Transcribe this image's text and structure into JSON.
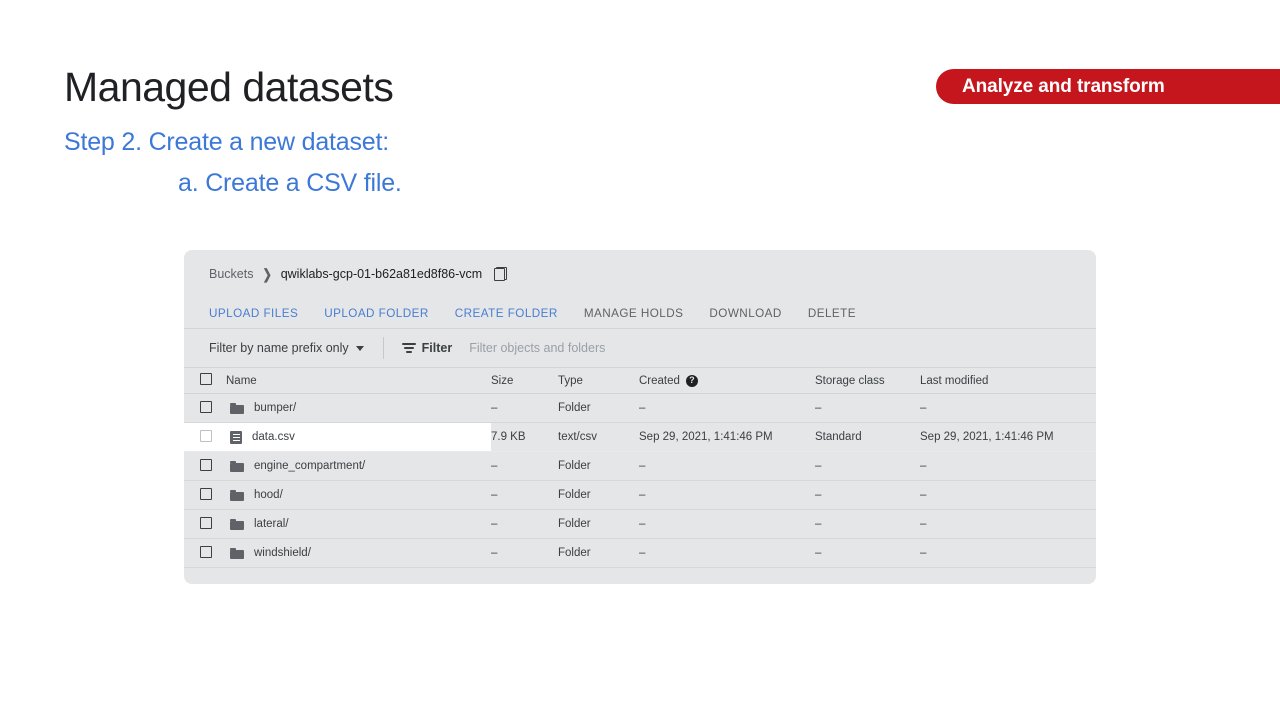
{
  "slide": {
    "title": "Managed datasets",
    "step": "Step 2. Create a new dataset:",
    "substep": "a. Create a CSV file.",
    "banner_label": "Analyze and transform",
    "title_color": "#202124",
    "step_color": "#3c78d8",
    "banner_color": "#c5161d"
  },
  "console": {
    "breadcrumb": {
      "root": "Buckets",
      "separator": "❯",
      "current": "qwiklabs-gcp-01-b62a81ed8f86-vcm",
      "copy_icon": "copy-icon"
    },
    "toolbar": [
      {
        "label": "UPLOAD FILES",
        "state": "enabled"
      },
      {
        "label": "UPLOAD FOLDER",
        "state": "enabled"
      },
      {
        "label": "CREATE FOLDER",
        "state": "enabled"
      },
      {
        "label": "MANAGE HOLDS",
        "state": "disabled"
      },
      {
        "label": "DOWNLOAD",
        "state": "disabled"
      },
      {
        "label": "DELETE",
        "state": "disabled"
      }
    ],
    "filter_bar": {
      "prefix_mode": "Filter by name prefix only",
      "dropdown_icon": "chevron-down-icon",
      "filter_icon": "filter-icon",
      "filter_label": "Filter",
      "filter_placeholder": "Filter objects and folders",
      "filter_value": ""
    },
    "table": {
      "headers": {
        "name": "Name",
        "size": "Size",
        "type": "Type",
        "created": "Created",
        "created_help_icon": "help-icon",
        "created_help_glyph": "?",
        "storage_class": "Storage class",
        "last_modified": "Last modified"
      },
      "rows": [
        {
          "icon": "folder-icon",
          "name": "bumper/",
          "size": "–",
          "type": "Folder",
          "created": "–",
          "storage_class": "–",
          "last_modified": "–",
          "selected": false,
          "checked": false
        },
        {
          "icon": "file-icon",
          "name": "data.csv",
          "size": "7.9 KB",
          "type": "text/csv",
          "created": "Sep 29, 2021, 1:41:46 PM",
          "storage_class": "Standard",
          "last_modified": "Sep 29, 2021, 1:41:46 PM",
          "selected": true,
          "checked": false
        },
        {
          "icon": "folder-icon",
          "name": "engine_compartment/",
          "size": "–",
          "type": "Folder",
          "created": "–",
          "storage_class": "–",
          "last_modified": "–",
          "selected": false,
          "checked": false
        },
        {
          "icon": "folder-icon",
          "name": "hood/",
          "size": "–",
          "type": "Folder",
          "created": "–",
          "storage_class": "–",
          "last_modified": "–",
          "selected": false,
          "checked": false
        },
        {
          "icon": "folder-icon",
          "name": "lateral/",
          "size": "–",
          "type": "Folder",
          "created": "–",
          "storage_class": "–",
          "last_modified": "–",
          "selected": false,
          "checked": false
        },
        {
          "icon": "folder-icon",
          "name": "windshield/",
          "size": "–",
          "type": "Folder",
          "created": "–",
          "storage_class": "–",
          "last_modified": "–",
          "selected": false,
          "checked": false
        }
      ]
    }
  }
}
